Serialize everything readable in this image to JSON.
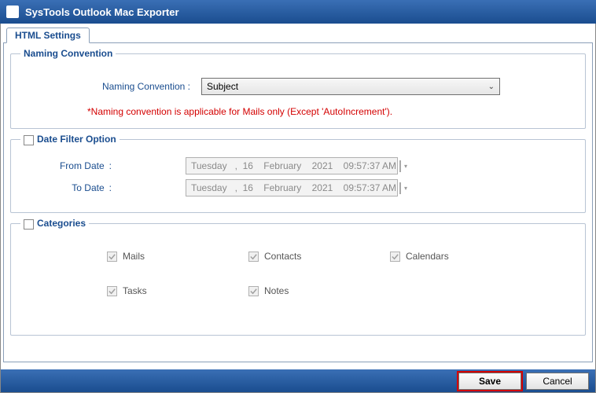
{
  "titlebar": {
    "app_name": "SysTools  Outlook Mac Exporter"
  },
  "tab": {
    "label": "HTML Settings"
  },
  "naming": {
    "legend": "Naming Convention",
    "label": "Naming Convention :",
    "selected": "Subject",
    "note": "*Naming convention is applicable for Mails only (Except 'AutoIncrement')."
  },
  "dateFilter": {
    "legend": "Date Filter Option",
    "from_label": "From Date",
    "to_label": "To Date",
    "from_value": "Tuesday   ,  16    February    2021    09:57:37 AM",
    "to_value": "Tuesday   ,  16    February    2021    09:57:37 AM"
  },
  "categories": {
    "legend": "Categories",
    "items": {
      "mails": "Mails",
      "contacts": "Contacts",
      "calendars": "Calendars",
      "tasks": "Tasks",
      "notes": "Notes"
    }
  },
  "footer": {
    "save": "Save",
    "cancel": "Cancel"
  }
}
